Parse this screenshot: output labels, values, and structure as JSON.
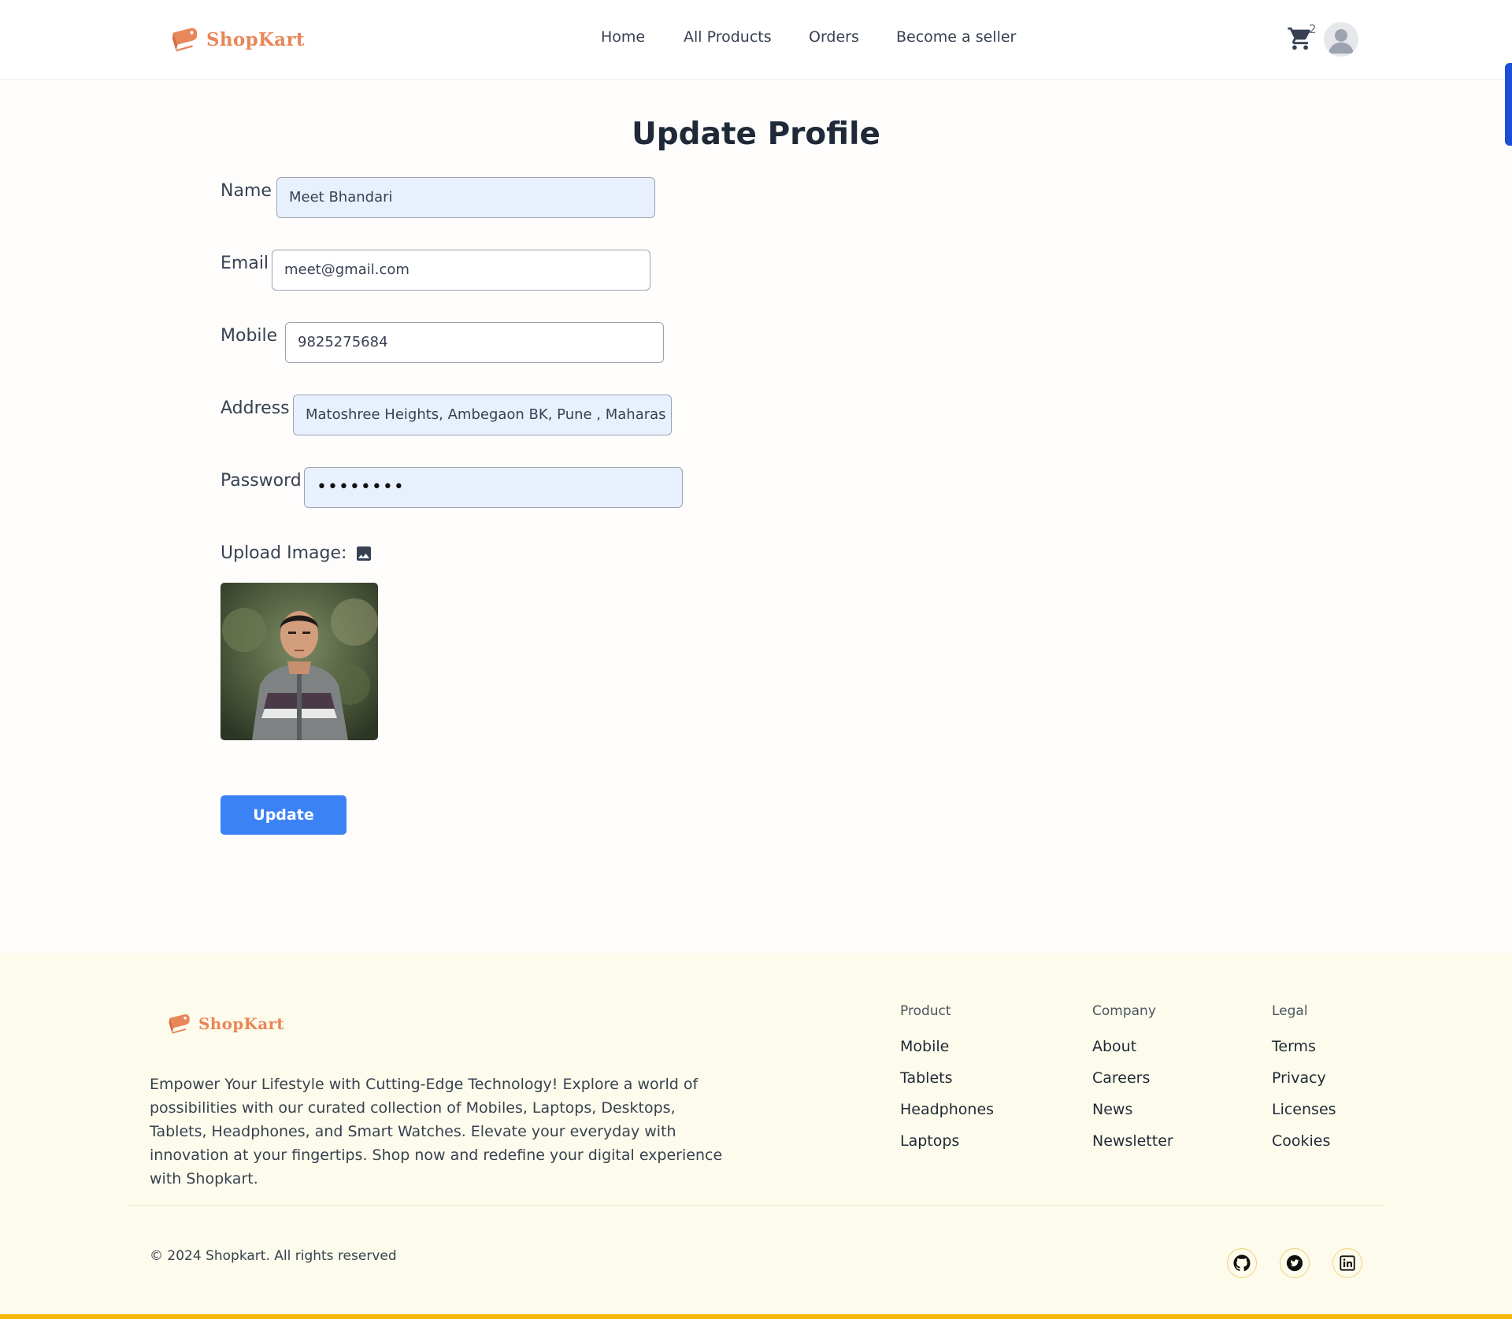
{
  "header": {
    "brand": "ShopKart",
    "nav": [
      {
        "label": "Home"
      },
      {
        "label": "All Products"
      },
      {
        "label": "Orders"
      },
      {
        "label": "Become a seller"
      }
    ],
    "cart_count": "2",
    "icons": {
      "logo": "shopping-tag-icon",
      "cart": "cart-icon",
      "avatar": "user-avatar-icon"
    }
  },
  "form": {
    "title": "Update Profile",
    "fields": {
      "name": {
        "label": "Name",
        "value": "Meet Bhandari"
      },
      "email": {
        "label": "Email",
        "value": "meet@gmail.com"
      },
      "mobile": {
        "label": "Mobile",
        "value": "9825275684"
      },
      "address": {
        "label": "Address",
        "value": "Matoshree Heights, Ambegaon BK, Pune , Maharas"
      },
      "password": {
        "label": "Password",
        "value": "••••••••"
      }
    },
    "upload_label": "Upload Image:",
    "upload_icon": "image-icon",
    "photo_alt": "profile-photo",
    "update_label": "Update",
    "colors": {
      "button": "#3b82f6",
      "autofill": "#e8f0fe"
    }
  },
  "footer": {
    "brand": "ShopKart",
    "description": "Empower Your Lifestyle with Cutting-Edge Technology! Explore a world of possibilities with our curated collection of Mobiles, Laptops, Desktops, Tablets, Headphones, and Smart Watches. Elevate your everyday with innovation at your fingertips. Shop now and redefine your digital experience with Shopkart.",
    "columns": [
      {
        "heading": "Product",
        "links": [
          "Mobile",
          "Tablets",
          "Headphones",
          "Laptops"
        ]
      },
      {
        "heading": "Company",
        "links": [
          "About",
          "Careers",
          "News",
          "Newsletter"
        ]
      },
      {
        "heading": "Legal",
        "links": [
          "Terms",
          "Privacy",
          "Licenses",
          "Cookies"
        ]
      }
    ],
    "copyright": "© 2024 Shopkart. All rights reserved",
    "social": [
      "github-icon",
      "twitter-icon",
      "linkedin-icon"
    ],
    "colors": {
      "background": "#fdfbeb",
      "accent_bar": "#f5b800",
      "brand": "#e8875a"
    }
  }
}
